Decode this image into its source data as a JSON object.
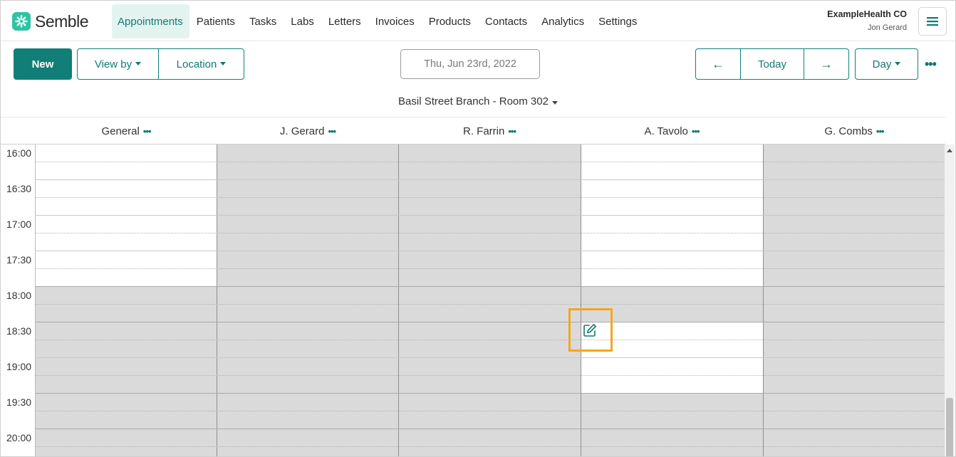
{
  "brand": {
    "name": "Semble",
    "logo_icon": "semble-logo-icon",
    "accent": "#117a72"
  },
  "nav": {
    "items": [
      {
        "label": "Appointments",
        "active": true
      },
      {
        "label": "Patients"
      },
      {
        "label": "Tasks"
      },
      {
        "label": "Labs"
      },
      {
        "label": "Letters"
      },
      {
        "label": "Invoices"
      },
      {
        "label": "Products"
      },
      {
        "label": "Contacts"
      },
      {
        "label": "Analytics"
      },
      {
        "label": "Settings"
      }
    ]
  },
  "account": {
    "org": "ExampleHealth CO",
    "user": "Jon Gerard",
    "menu_icon": "hamburger-icon"
  },
  "toolbar": {
    "new_label": "New",
    "view_by_label": "View by",
    "location_label": "Location",
    "date": "Thu, Jun 23rd, 2022",
    "prev_label": "←",
    "today_label": "Today",
    "next_label": "→",
    "view_mode": "Day",
    "more_icon": "more-horizontal-icon"
  },
  "room": {
    "label": "Basil Street Branch - Room 302"
  },
  "calendar": {
    "columns": [
      "General",
      "J. Gerard",
      "R. Farrin",
      "A. Tavolo",
      "G. Combs"
    ],
    "column_menu_glyph": "•••",
    "times": [
      "16:00",
      "16:30",
      "17:00",
      "17:30",
      "18:00",
      "18:30",
      "19:00",
      "19:30",
      "20:00"
    ],
    "availability": {
      "General": [
        [
          "16:00",
          "18:00"
        ]
      ],
      "A. Tavolo": [
        [
          "16:00",
          "18:00"
        ],
        [
          "18:30",
          "19:30"
        ]
      ]
    },
    "highlighted_action_icon": "edit-icon"
  },
  "colors": {
    "unavailable": "#dadada",
    "available": "#ffffff",
    "highlight": "#f5a61b"
  }
}
